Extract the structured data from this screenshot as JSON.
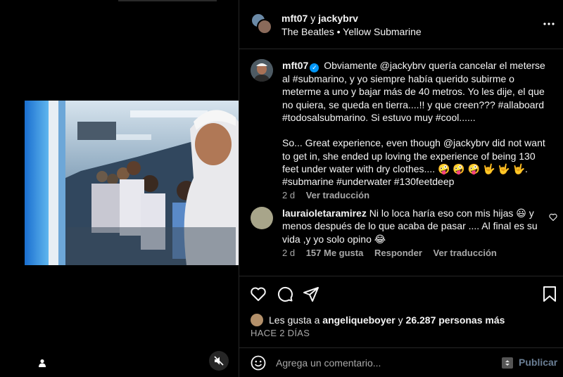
{
  "header": {
    "user1": "mft07",
    "conjunction": "y",
    "user2": "jackybrv",
    "audio": "The Beatles • Yellow Submarine"
  },
  "caption": {
    "username": "mft07",
    "text": "Obviamente @jackybrv quería cancelar el meterse al #submarino, y yo siempre había querido subirme o meterme a uno y bajar más de 40 metros. Yo les dije, el que no quiera, se queda en tierra....!! y que creen??? #allaboard #todosalsubmarino. Si estuvo muy #cool......",
    "text_en": "So... Great experience, even though @jackybrv did not want to get in, she ended up loving the experience of being 130 feet under water with dry clothes.... 🤪 🤪 🤪 🤟 🤟 🤟. #submarine #underwater #130feetdeep",
    "time": "2 d",
    "translate": "Ver traducción"
  },
  "comment": {
    "username": "lauraioletaramirez",
    "text": "Ni lo loca haría eso con mis hijas 😃 y menos después de lo que acaba de pasar .... Al final es su vida ,y yo solo opino 😂",
    "time": "2 d",
    "likes": "157 Me gusta",
    "reply": "Responder",
    "translate": "Ver traducción"
  },
  "likes": {
    "prefix": "Les gusta a",
    "user": "angeliqueboyer",
    "middle": "y",
    "count": "26.287 personas más"
  },
  "time_ago": "HACE 2 DÍAS",
  "add_comment": {
    "placeholder": "Agrega un comentario...",
    "post": "Publicar"
  },
  "icons": {
    "heart": "heart-icon",
    "comment": "comment-icon",
    "share": "share-icon",
    "save": "bookmark-icon",
    "more": "more-horizontal-icon",
    "emoji": "emoji-icon",
    "muted": "muted-speaker-icon",
    "user_tag": "user-tag-icon"
  },
  "colors": {
    "verified": "#0095f6",
    "post_button": "#6a7e94"
  }
}
